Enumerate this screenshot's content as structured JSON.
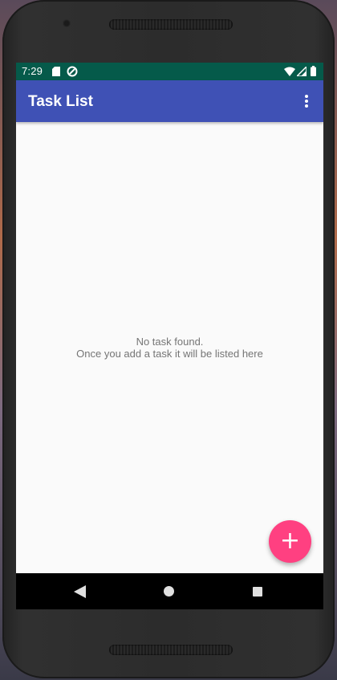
{
  "status_bar": {
    "time": "7:29",
    "icons": [
      "sd-card-icon",
      "sync-icon",
      "wifi-icon",
      "signal-icon",
      "battery-icon"
    ]
  },
  "app_bar": {
    "title": "Task List",
    "overflow_icon": "more-vert-icon"
  },
  "main": {
    "empty_title": "No task found.",
    "empty_subtitle": "Once you add a task it will be listed here"
  },
  "fab": {
    "label": "+",
    "icon": "add-icon",
    "color": "#ff4081"
  },
  "nav_bar": {
    "icons": [
      "back-icon",
      "home-icon",
      "recents-icon"
    ]
  },
  "colors": {
    "primary": "#3f51b5",
    "status_bar": "#055a4a",
    "accent": "#ff4081",
    "background": "#fafafa"
  }
}
